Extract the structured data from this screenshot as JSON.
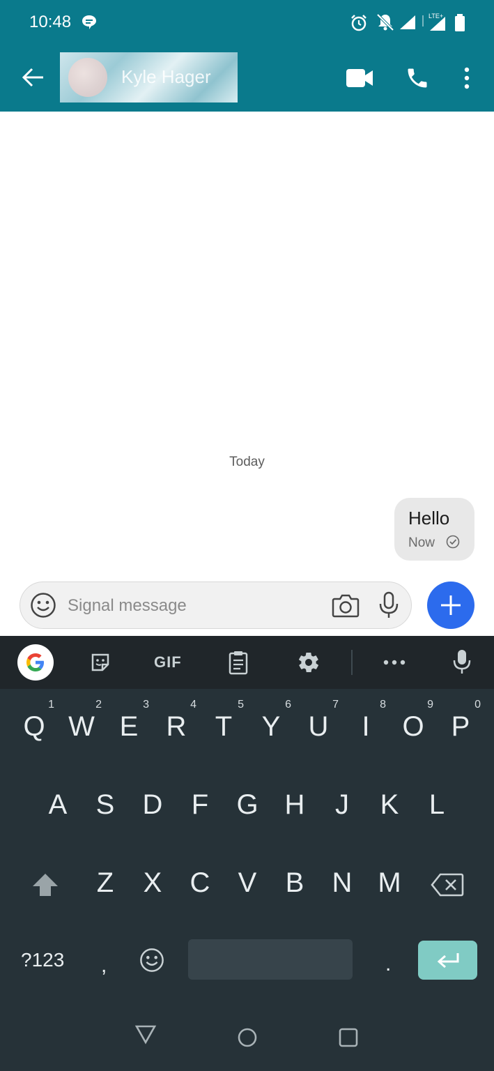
{
  "status_bar": {
    "time": "10:48"
  },
  "header": {
    "contact_name": "Kyle Hager"
  },
  "conversation": {
    "date_divider": "Today",
    "messages": [
      {
        "text": "Hello",
        "time": "Now",
        "direction": "outgoing"
      }
    ]
  },
  "compose": {
    "placeholder": "Signal message"
  },
  "keyboard": {
    "toolbar": {
      "gif_label": "GIF"
    },
    "row1": [
      {
        "key": "Q",
        "hint": "1"
      },
      {
        "key": "W",
        "hint": "2"
      },
      {
        "key": "E",
        "hint": "3"
      },
      {
        "key": "R",
        "hint": "4"
      },
      {
        "key": "T",
        "hint": "5"
      },
      {
        "key": "Y",
        "hint": "6"
      },
      {
        "key": "U",
        "hint": "7"
      },
      {
        "key": "I",
        "hint": "8"
      },
      {
        "key": "O",
        "hint": "9"
      },
      {
        "key": "P",
        "hint": "0"
      }
    ],
    "row2": [
      "A",
      "S",
      "D",
      "F",
      "G",
      "H",
      "J",
      "K",
      "L"
    ],
    "row3": [
      "Z",
      "X",
      "C",
      "V",
      "B",
      "N",
      "M"
    ],
    "symbols_label": "?123",
    "comma": ",",
    "period": "."
  },
  "colors": {
    "app_bar": "#0a7a8c",
    "fab": "#2c6bed",
    "keyboard_bg": "#263238",
    "enter_key": "#80cbc4",
    "bubble": "#e8e8e8"
  }
}
